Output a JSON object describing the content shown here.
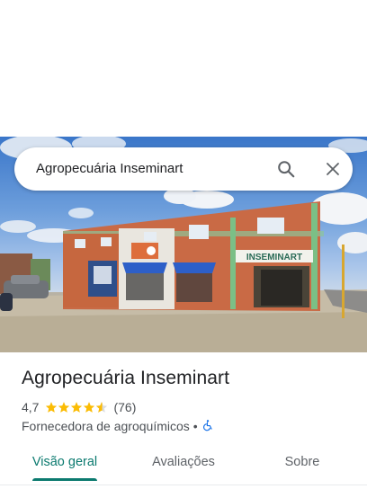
{
  "search": {
    "query": "Agropecuária Inseminart"
  },
  "photo": {
    "sign_text": "INSEMINART"
  },
  "place": {
    "name": "Agropecuária Inseminart",
    "rating": "4,7",
    "stars_filled": 4.5,
    "review_count": "(76)",
    "category": "Fornecedora de agroquímicos",
    "separator": "•",
    "accessibility_icon": "wheelchair-icon"
  },
  "tabs": [
    {
      "label": "Visão geral",
      "active": true
    },
    {
      "label": "Avaliações",
      "active": false
    },
    {
      "label": "Sobre",
      "active": false
    }
  ],
  "colors": {
    "accent": "#0b7a6f",
    "star": "#fbbc04",
    "accessibility": "#1a73e8"
  }
}
